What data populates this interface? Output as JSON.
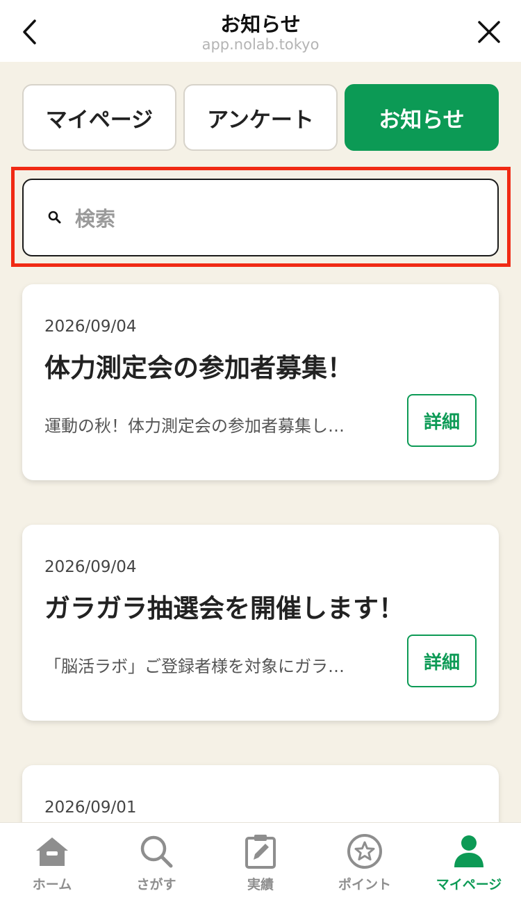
{
  "header": {
    "title": "お知らせ",
    "url": "app.nolab.tokyo"
  },
  "tabs": [
    {
      "label": "マイページ",
      "active": false
    },
    {
      "label": "アンケート",
      "active": false
    },
    {
      "label": "お知らせ",
      "active": true
    }
  ],
  "search": {
    "placeholder": "検索"
  },
  "notices": [
    {
      "date": "2026/09/04",
      "title": "体力測定会の参加者募集！",
      "excerpt": "運動の秋！体力測定会の参加者募集し…",
      "detail_label": "詳細"
    },
    {
      "date": "2026/09/04",
      "title": "ガラガラ抽選会を開催します！",
      "excerpt": "「脳活ラボ」ご登録者様を対象にガラ…",
      "detail_label": "詳細"
    },
    {
      "date": "2026/09/01"
    }
  ],
  "bottom_nav": [
    {
      "label": "ホーム",
      "icon": "home-icon",
      "active": false
    },
    {
      "label": "さがす",
      "icon": "search-icon",
      "active": false
    },
    {
      "label": "実績",
      "icon": "clipboard-edit-icon",
      "active": false
    },
    {
      "label": "ポイント",
      "icon": "star-coin-icon",
      "active": false
    },
    {
      "label": "マイページ",
      "icon": "user-icon",
      "active": true
    }
  ],
  "colors": {
    "accent": "#0c9a55",
    "background": "#f5f1e6",
    "highlight": "#f02a14"
  }
}
